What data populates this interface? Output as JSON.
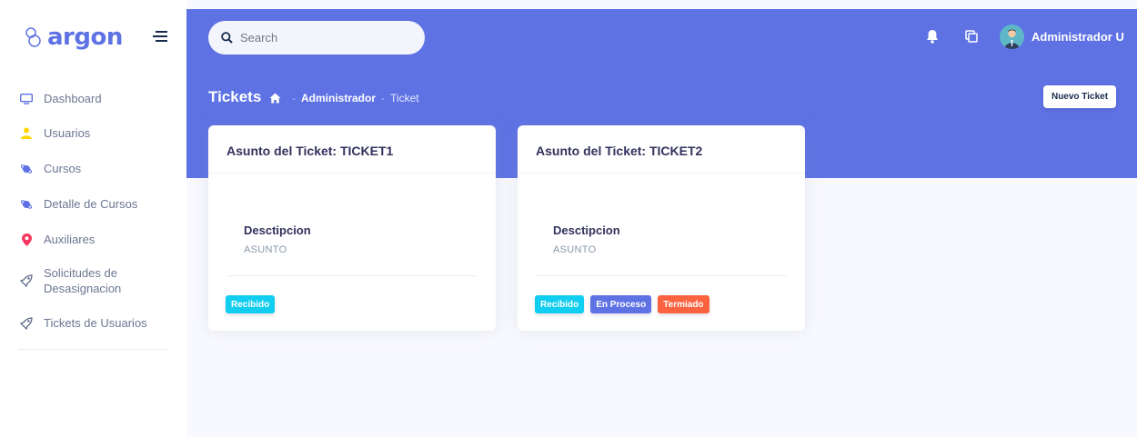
{
  "brand": {
    "name": "argon"
  },
  "sidebar": {
    "items": [
      {
        "label": "Dashboard",
        "icon": "tv-icon",
        "color": "#5e72e4"
      },
      {
        "label": "Usuarios",
        "icon": "user-icon",
        "color": "#ffd600"
      },
      {
        "label": "Cursos",
        "icon": "planet-icon",
        "color": "#5e72e4"
      },
      {
        "label": "Detalle de Cursos",
        "icon": "planet-icon",
        "color": "#5e72e4"
      },
      {
        "label": "Auxiliares",
        "icon": "pin-icon",
        "color": "#f5365c"
      },
      {
        "label": "Solicitudes de Desasignacion",
        "label_line1": "Solicitudes de",
        "label_line2": "Desasignacion",
        "icon": "rocket-icon",
        "color": "#525f7f"
      },
      {
        "label": "Tickets de Usuarios",
        "icon": "rocket-icon",
        "color": "#525f7f"
      }
    ]
  },
  "header": {
    "search_placeholder": "Search",
    "user_name": "Administrador U"
  },
  "page": {
    "title": "Tickets",
    "breadcrumb": {
      "sep": "-",
      "parent": "Administrador",
      "current": "Ticket"
    },
    "new_button": "Nuevo Ticket"
  },
  "tickets": [
    {
      "subject": "Asunto del Ticket: TICKET1",
      "desc_label": "Desctipcion",
      "desc_value": "ASUNTO",
      "badges": [
        {
          "label": "Recibido",
          "color": "#11cdef"
        }
      ]
    },
    {
      "subject": "Asunto del Ticket: TICKET2",
      "desc_label": "Desctipcion",
      "desc_value": "ASUNTO",
      "badges": [
        {
          "label": "Recibido",
          "color": "#11cdef"
        },
        {
          "label": "En Proceso",
          "color": "#5e72e4"
        },
        {
          "label": "Termiado",
          "color": "#fb6340"
        }
      ]
    }
  ],
  "colors": {
    "primary": "#5e72e4",
    "info": "#11cdef",
    "warning": "#fb6340"
  }
}
